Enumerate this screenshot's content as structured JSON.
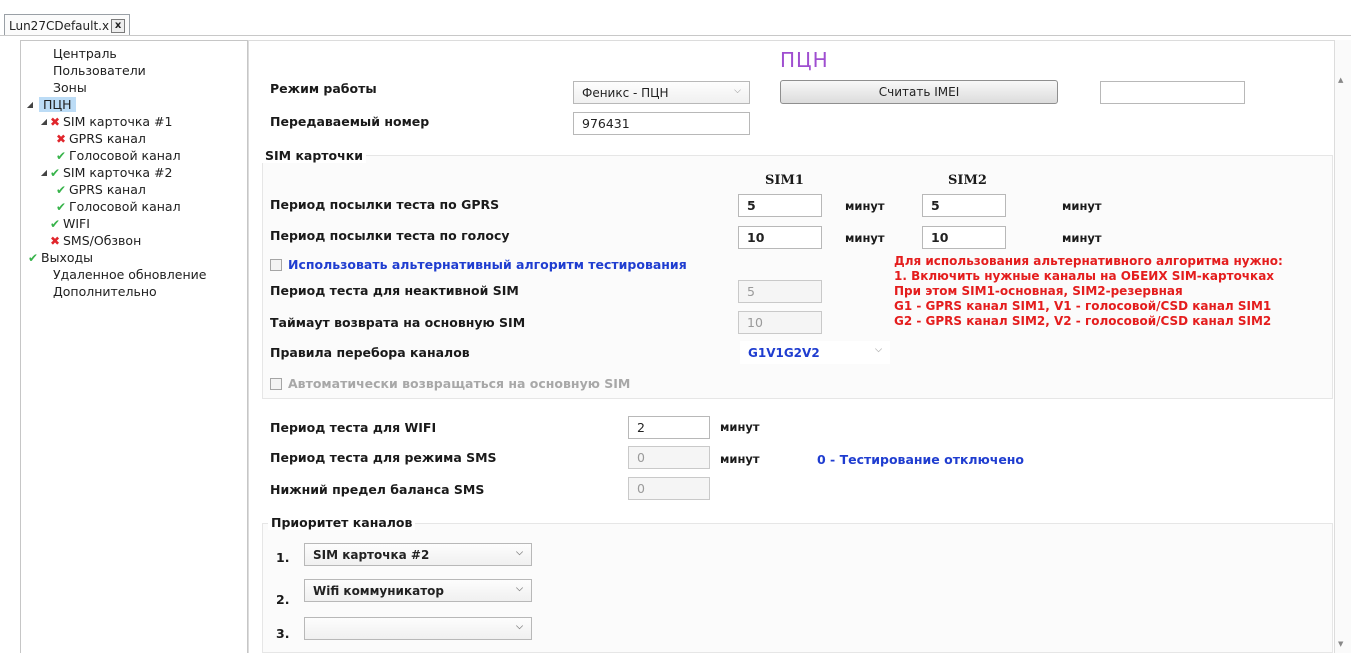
{
  "tab": {
    "title": "Lun27CDefault.x",
    "close": "x"
  },
  "tree": {
    "items": [
      {
        "label": "Централь",
        "indent": 0,
        "status": "",
        "caret": ""
      },
      {
        "label": "Пользователи",
        "indent": 0,
        "status": "",
        "caret": ""
      },
      {
        "label": "Зоны",
        "indent": 0,
        "status": "",
        "caret": ""
      },
      {
        "label": "ПЦН",
        "indent": 0,
        "status": "",
        "caret": "◢",
        "selected": true
      },
      {
        "label": "SIM карточка #1",
        "indent": 1,
        "status": "err",
        "caret": "◢"
      },
      {
        "label": "GPRS канал",
        "indent": 2,
        "status": "err",
        "caret": ""
      },
      {
        "label": "Голосовой канал",
        "indent": 2,
        "status": "ok",
        "caret": ""
      },
      {
        "label": "SIM карточка #2",
        "indent": 1,
        "status": "ok",
        "caret": "◢"
      },
      {
        "label": "GPRS канал",
        "indent": 2,
        "status": "ok",
        "caret": ""
      },
      {
        "label": "Голосовой канал",
        "indent": 2,
        "status": "ok",
        "caret": ""
      },
      {
        "label": "WIFI",
        "indent": 1,
        "status": "ok",
        "caret": ""
      },
      {
        "label": "SMS/Обзвон",
        "indent": 1,
        "status": "err",
        "caret": ""
      },
      {
        "label": "Выходы",
        "indent": 0,
        "status": "ok",
        "caret": ""
      },
      {
        "label": "Удаленное обновление",
        "indent": 0,
        "status": "",
        "caret": ""
      },
      {
        "label": "Дополнительно",
        "indent": 0,
        "status": "",
        "caret": ""
      }
    ]
  },
  "icons": {
    "ok": "check-icon",
    "err": "cross-icon",
    "ok_glyph": "✔",
    "err_glyph": "✖"
  },
  "panel": {
    "title": "ПЦН",
    "mode_label": "Режим работы",
    "mode_value": "Феникс - ПЦН",
    "read_imei_button": "Считать IMEI",
    "imei_value": "",
    "number_label": "Передаваемый номер",
    "number_value": "976431",
    "sim_group_title": "SIM карточки",
    "sim1_header": "SIM1",
    "sim2_header": "SIM2",
    "gprs_period_label": "Период посылки теста по GPRS",
    "gprs_sim1": "5",
    "gprs_sim2": "5",
    "voice_period_label": "Период посылки теста по голосу",
    "voice_sim1": "10",
    "voice_sim2": "10",
    "minutes": "минут",
    "alt_algo_label": "Использовать альтернативный алгоритм тестирования",
    "inactive_sim_label": "Период теста для неактивной SIM",
    "inactive_sim_value": "5",
    "return_timeout_label": "Таймаут возврата на основную SIM",
    "return_timeout_value": "10",
    "rules_label": "Правила перебора каналов",
    "rules_value": "G1V1G2V2",
    "auto_return_label": "Автоматически возвращаться на основную SIM",
    "note_lines": [
      "Для использования альтернативного алгоритма нужно:",
      "1. Включить нужные каналы на ОБЕИХ SIM-карточках",
      "При этом SIM1-основная, SIM2-резервная",
      "G1 - GPRS канал SIM1, V1 - голосовой/CSD канал SIM1",
      "G2 - GPRS канал SIM2, V2 - голосовой/CSD канал SIM2"
    ],
    "wifi_period_label": "Период теста для WIFI",
    "wifi_period_value": "2",
    "sms_period_label": "Период теста для режима SMS",
    "sms_period_value": "0",
    "sms_hint": "0 - Тестирование отключено",
    "sms_balance_label": "Нижний предел баланса SMS",
    "sms_balance_value": "0",
    "priority_group_title": "Приоритет каналов",
    "priority": [
      {
        "num": "1.",
        "value": "SIM карточка #2"
      },
      {
        "num": "2.",
        "value": "Wifi коммуникатор"
      },
      {
        "num": "3.",
        "value": ""
      }
    ]
  }
}
